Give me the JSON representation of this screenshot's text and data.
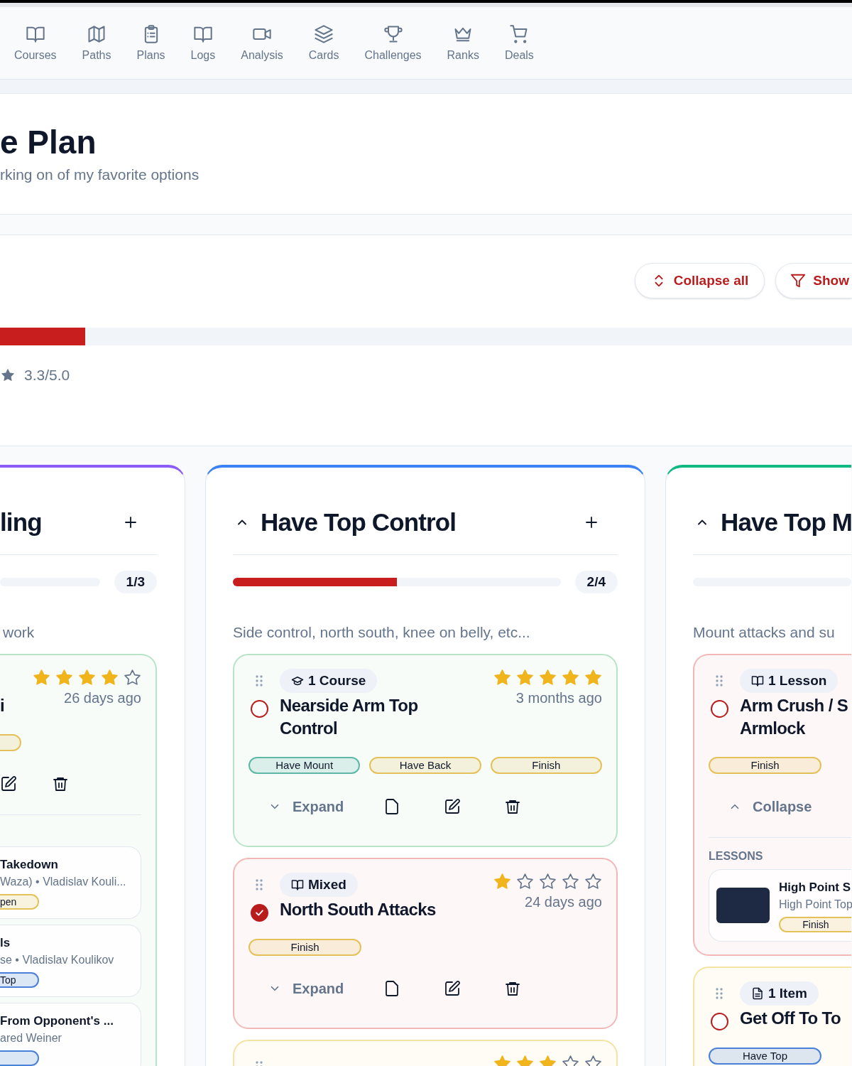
{
  "nav": [
    {
      "label": "Courses",
      "kind": "book"
    },
    {
      "label": "Paths",
      "kind": "map"
    },
    {
      "label": "Plans",
      "kind": "clipboard"
    },
    {
      "label": "Logs",
      "kind": "book"
    },
    {
      "label": "Analysis",
      "kind": "video"
    },
    {
      "label": "Cards",
      "kind": "layers"
    },
    {
      "label": "Challenges",
      "kind": "trophy"
    },
    {
      "label": "Ranks",
      "kind": "crown"
    },
    {
      "label": "Deals",
      "kind": "cart"
    }
  ],
  "header": {
    "title": "e Plan",
    "subtitle": "rking on of my favorite options"
  },
  "toolbar": [
    {
      "label": "Collapse all",
      "kind": "collapse"
    },
    {
      "label": "Show",
      "kind": "filter"
    }
  ],
  "overall": {
    "level": 0.1,
    "rating": "3.3/5.0"
  },
  "columns": [
    {
      "title": "ling",
      "color": "#8b5cf6",
      "count": "1/3",
      "level": 0,
      "description": "work",
      "cards": [
        {
          "color": "#b7e4c7",
          "title": "i",
          "stars": 4,
          "time": "26 days ago",
          "tags": [
            {
              "color": "#e5c15a"
            }
          ],
          "actions": [
            {
              "kind": "edit"
            },
            {
              "kind": "trash"
            }
          ],
          "lessons": {
            "items": [
              {
                "title": "Takedown",
                "meta": "Waza) • Vladislav Kouli...",
                "tag": {
                  "label": "pen",
                  "color": "#e5c15a"
                }
              },
              {
                "title": "ls",
                "meta": "se • Vladislav Koulikov",
                "tag": {
                  "label": "Top",
                  "color": "#4a80d9"
                }
              },
              {
                "title": "From Opponent's ...",
                "meta": "ared Weiner",
                "tag": {
                  "color": "#4a80d9"
                }
              }
            ]
          }
        }
      ]
    },
    {
      "title": "Have Top Control",
      "color": "#3b82f6",
      "expanded": true,
      "count": "2/4",
      "level": 0.5,
      "description": "Side control, north south, knee on belly, etc...",
      "cards": [
        {
          "color": "#b7e4c7",
          "badge": {
            "kind": "course",
            "label": "1 Course"
          },
          "done": false,
          "title": "Nearside Arm Top Control",
          "stars": 5,
          "time": "3 months ago",
          "tags": [
            {
              "label": "Have Mount",
              "color": "#5fb8a5"
            },
            {
              "label": "Have Back",
              "color": "#e5c15a"
            },
            {
              "label": "Finish",
              "color": "#e5c15a"
            }
          ],
          "toggle": {
            "label": "Expand",
            "expanded": false
          },
          "actions": [
            {
              "kind": "file"
            },
            {
              "kind": "edit"
            },
            {
              "kind": "trash"
            }
          ]
        },
        {
          "color": "#f2b8b8",
          "badge": {
            "kind": "book",
            "label": "Mixed"
          },
          "done": true,
          "title": "North South Attacks",
          "stars": 1,
          "time": "24 days ago",
          "tags": [
            {
              "label": "Finish",
              "color": "#e5c15a"
            }
          ],
          "toggle": {
            "label": "Expand",
            "expanded": false
          },
          "actions": [
            {
              "kind": "file"
            },
            {
              "kind": "edit"
            },
            {
              "kind": "trash"
            }
          ]
        },
        {
          "color": "#f5e3a3",
          "stars": 3
        }
      ]
    },
    {
      "title": "Have Top M",
      "color": "#10b981",
      "expanded": true,
      "level": 0,
      "description": "Mount attacks and su",
      "cards": [
        {
          "color": "#f2b8b8",
          "badge": {
            "kind": "book",
            "label": "1 Lesson"
          },
          "done": false,
          "title": "Arm Crush / S\nArmlock",
          "tags": [
            {
              "label": "Finish",
              "color": "#e5c15a"
            }
          ],
          "toggle": {
            "label": "Collapse",
            "expanded": true
          },
          "lessons": {
            "heading": "LESSONS",
            "items": [
              {
                "thumbnail": true,
                "title": "High Point S",
                "meta": "High Point Top",
                "tag": {
                  "label": "Finish",
                  "color": "#e5c15a"
                }
              }
            ]
          }
        },
        {
          "color": "#f5e3a3",
          "badge": {
            "kind": "filetext",
            "label": "1 Item"
          },
          "done": false,
          "title": "Get Off To To",
          "tags": [
            {
              "label": "Have Top",
              "color": "#4a80d9"
            }
          ]
        }
      ]
    }
  ]
}
